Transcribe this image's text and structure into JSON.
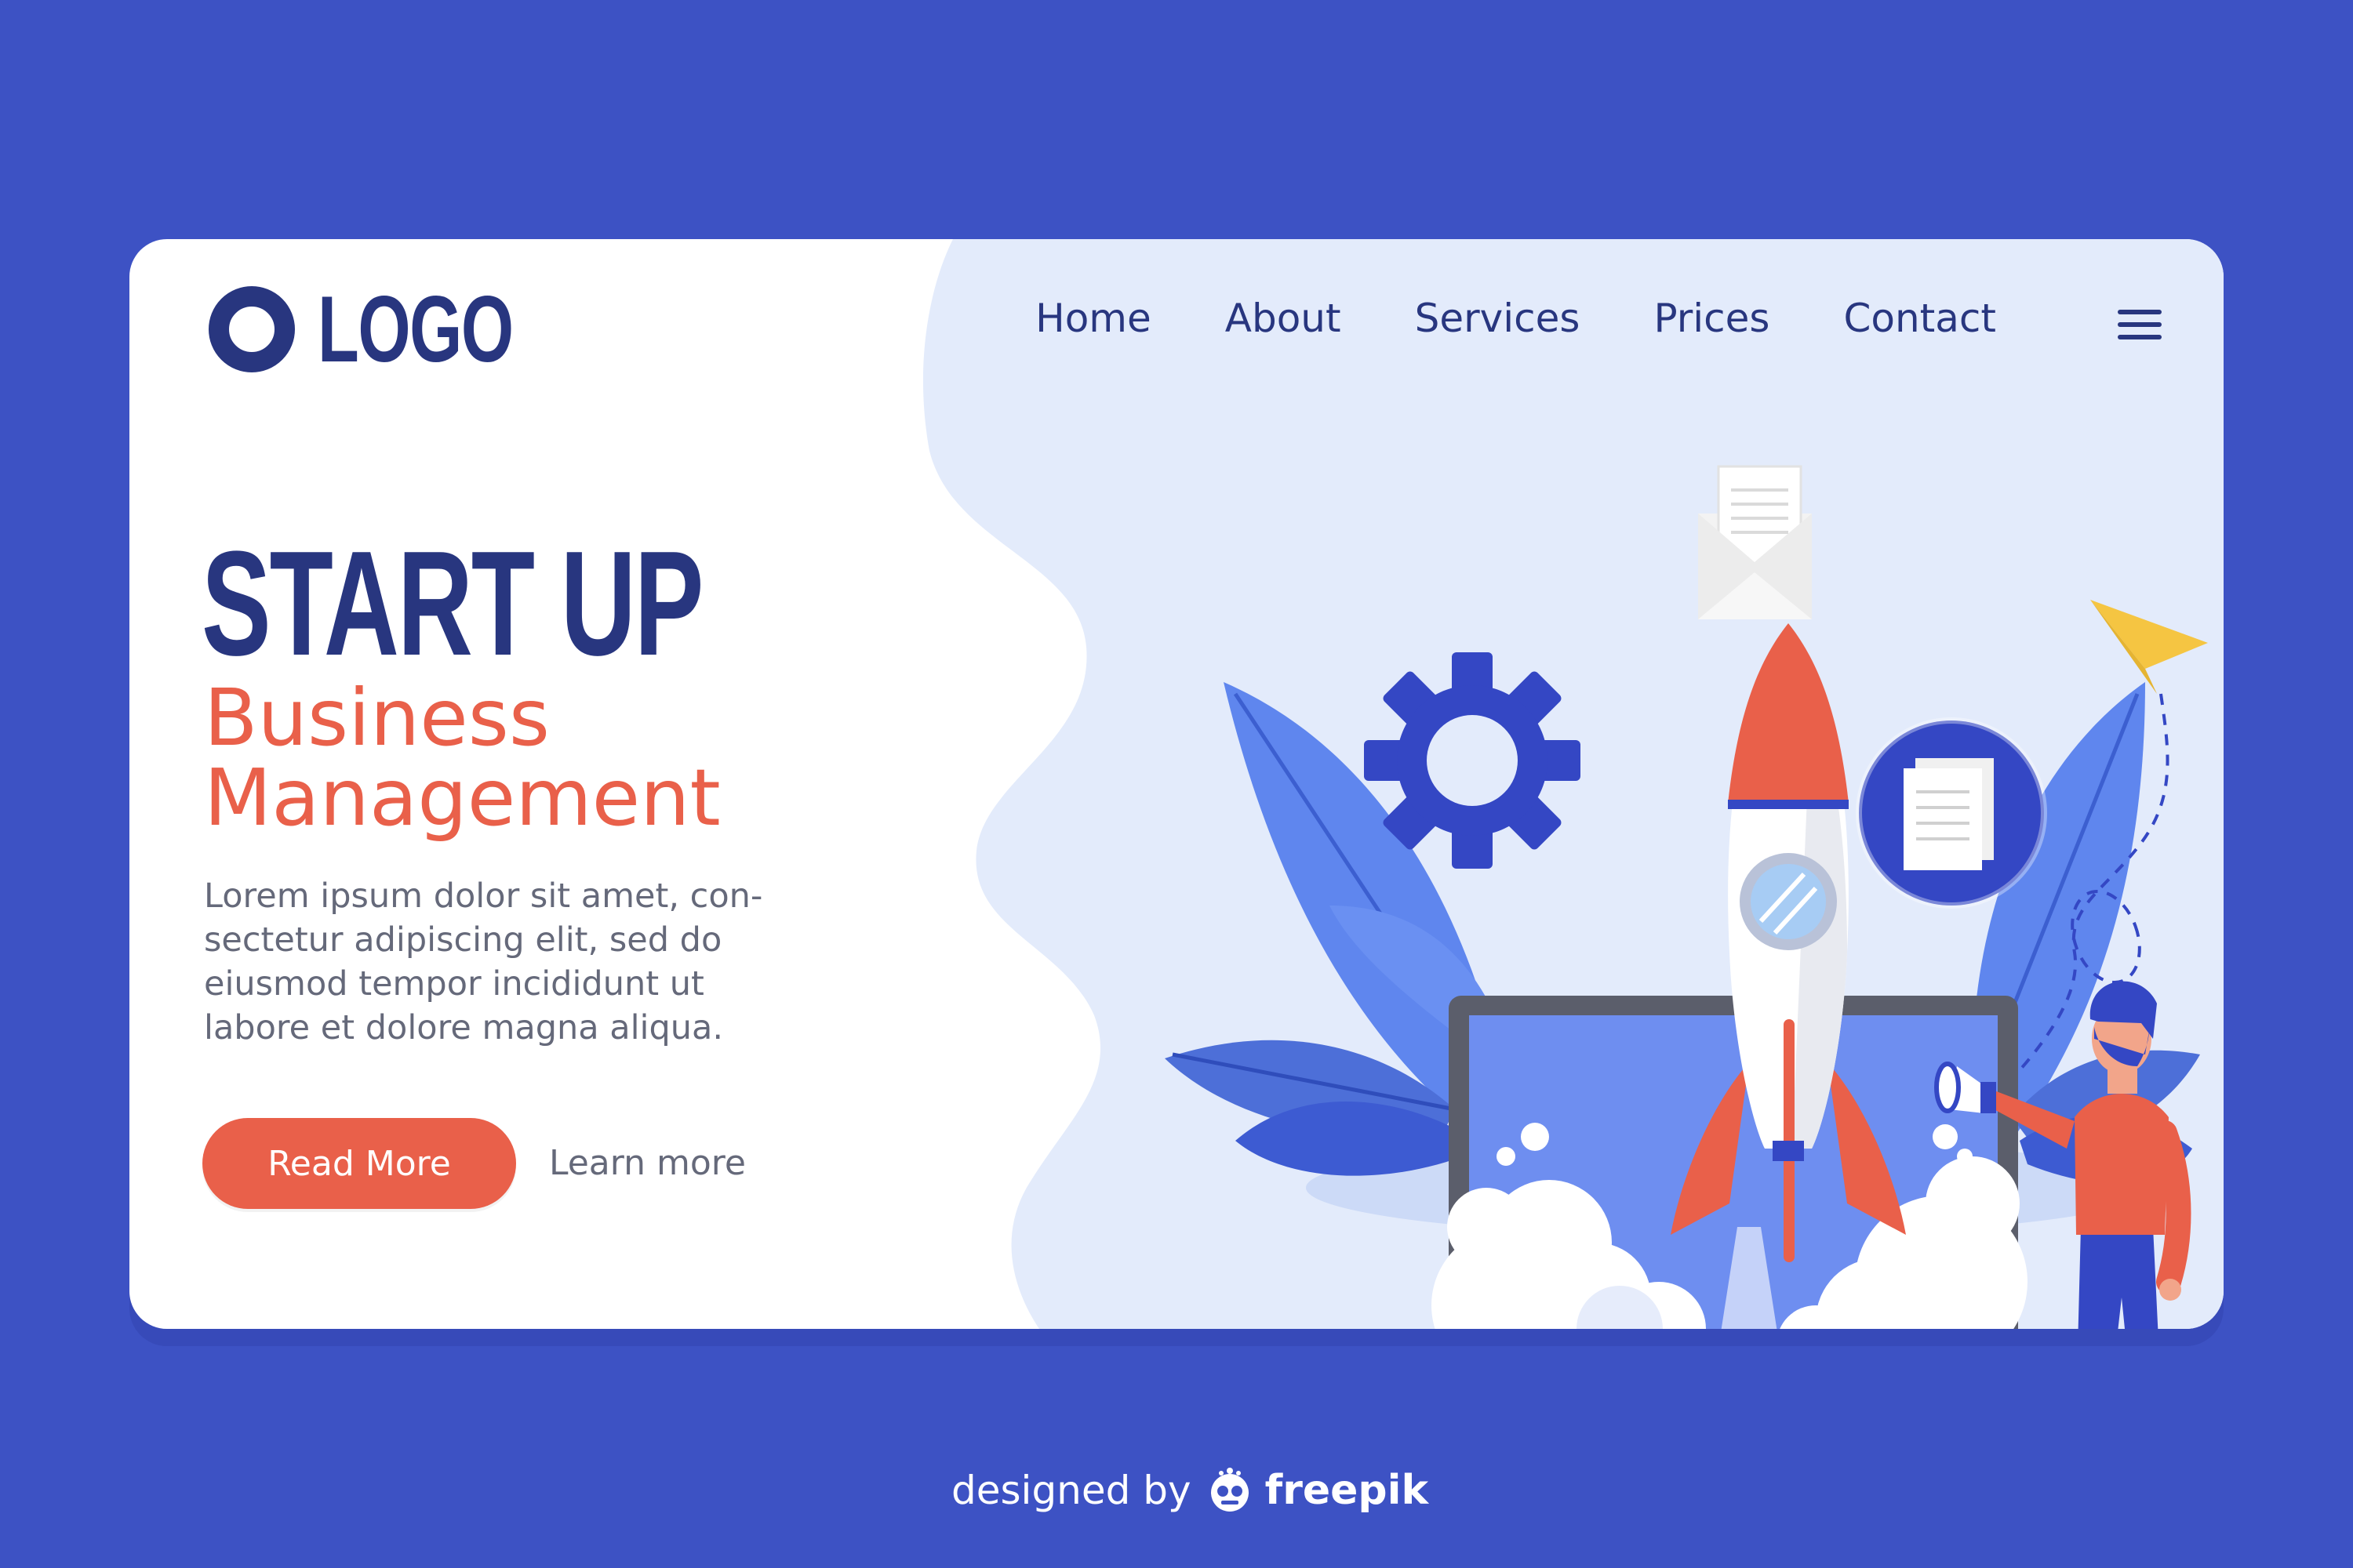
{
  "logo": {
    "text": "LOGO"
  },
  "nav": {
    "items": [
      {
        "label": "Home"
      },
      {
        "label": "About"
      },
      {
        "label": "Services"
      },
      {
        "label": "Prices"
      },
      {
        "label": "Contact"
      }
    ],
    "menu_icon": "hamburger-icon"
  },
  "hero": {
    "title": "START UP",
    "subtitle_line1": "Business",
    "subtitle_line2": "Management",
    "body_lines": [
      "Lorem ipsum dolor sit amet, con-",
      "sectetur adipiscing elit, sed do",
      "eiusmod tempor incididunt ut",
      "labore et dolore magna aliqua."
    ],
    "primary_button": "Read More",
    "secondary_link": "Learn more"
  },
  "illustration": {
    "icons": [
      "rocket-icon",
      "laptop-icon",
      "gear-icon",
      "envelope-icon",
      "document-icon",
      "paper-plane-icon",
      "megaphone-icon",
      "person-icon",
      "leaf-icon"
    ]
  },
  "credit": {
    "text": "designed by",
    "brand": "freepik",
    "icon": "freepik-logo-icon"
  },
  "colors": {
    "background": "#3d52c4",
    "navy": "#28367f",
    "accent": "#e9604a",
    "panel": "#e3ebfb",
    "body_text": "#65697a"
  }
}
